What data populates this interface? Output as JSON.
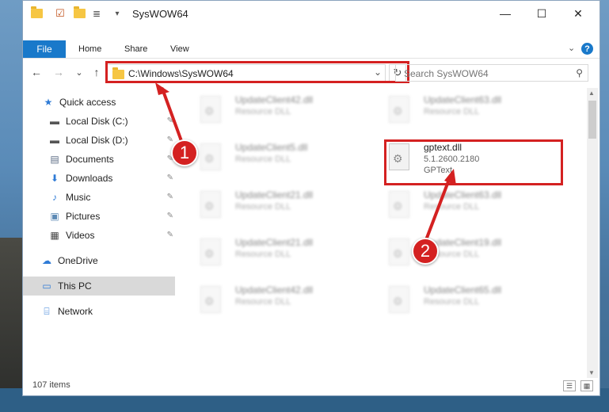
{
  "window": {
    "title": "SysWOW64"
  },
  "titlebar": {
    "min": "—",
    "max": "☐",
    "close": "✕",
    "qa_dropdown": "▾"
  },
  "ribbon": {
    "tabs": [
      "File",
      "Home",
      "Share",
      "View"
    ],
    "expand": "⌄",
    "help": "?"
  },
  "nav": {
    "back": "←",
    "forward": "→",
    "recent": "⌄",
    "up": "↑",
    "address": "C:\\Windows\\SysWOW64",
    "address_dropdown": "⌄",
    "refresh": "↻",
    "search_placeholder": "Search SysWOW64",
    "search_icon": "⚲"
  },
  "sidebar": {
    "items": [
      {
        "label": "Quick access",
        "icon": "★",
        "color": "#2f7bd6"
      },
      {
        "label": "Local Disk (C:)",
        "icon": "▬",
        "color": "#555555",
        "pin": "📌"
      },
      {
        "label": "Local Disk (D:)",
        "icon": "▬",
        "color": "#555555",
        "pin": "📌"
      },
      {
        "label": "Documents",
        "icon": "▤",
        "color": "#5d6d85",
        "pin": "📌"
      },
      {
        "label": "Downloads",
        "icon": "⬇",
        "color": "#2f7bd6",
        "pin": "📌"
      },
      {
        "label": "Music",
        "icon": "♪",
        "color": "#2f7bd6",
        "pin": "📌"
      },
      {
        "label": "Pictures",
        "icon": "▣",
        "color": "#5d8ab5",
        "pin": "📌"
      },
      {
        "label": "Videos",
        "icon": "▦",
        "color": "#444444",
        "pin": "📌"
      },
      {
        "label": "OneDrive",
        "icon": "☁",
        "color": "#2f7bd6"
      },
      {
        "label": "This PC",
        "icon": "▭",
        "color": "#2f7bd6"
      },
      {
        "label": "Network",
        "icon": "⌸",
        "color": "#2f7bd6"
      }
    ]
  },
  "files": {
    "left": [
      {
        "name": "UpdateClient42.dll",
        "desc": "Resource DLL"
      },
      {
        "name": "UpdateClient5.dll",
        "desc": "Resource DLL"
      },
      {
        "name": "UpdateClient21.dll",
        "desc": "Resource DLL"
      },
      {
        "name": "UpdateClient21.dll",
        "desc": "Resource DLL"
      },
      {
        "name": "UpdateClient42.dll",
        "desc": "Resource DLL"
      }
    ],
    "right": [
      {
        "name": "UpdateClient63.dll",
        "desc": "Resource DLL"
      },
      {
        "name": "gptext.dll",
        "version": "5.1.2600.2180",
        "desc": "GPText"
      },
      {
        "name": "UpdateClient63.dll",
        "desc": "Resource DLL"
      },
      {
        "name": "UpdateClient19.dll",
        "desc": "Resource DLL"
      },
      {
        "name": "UpdateClient65.dll",
        "desc": "Resource DLL"
      }
    ]
  },
  "status": {
    "count": "107 items",
    "details_view": "☰",
    "tiles_view": "▦"
  },
  "callouts": {
    "one": "1",
    "two": "2"
  },
  "colors": {
    "accent": "#1979ca",
    "highlight": "#d42121"
  }
}
